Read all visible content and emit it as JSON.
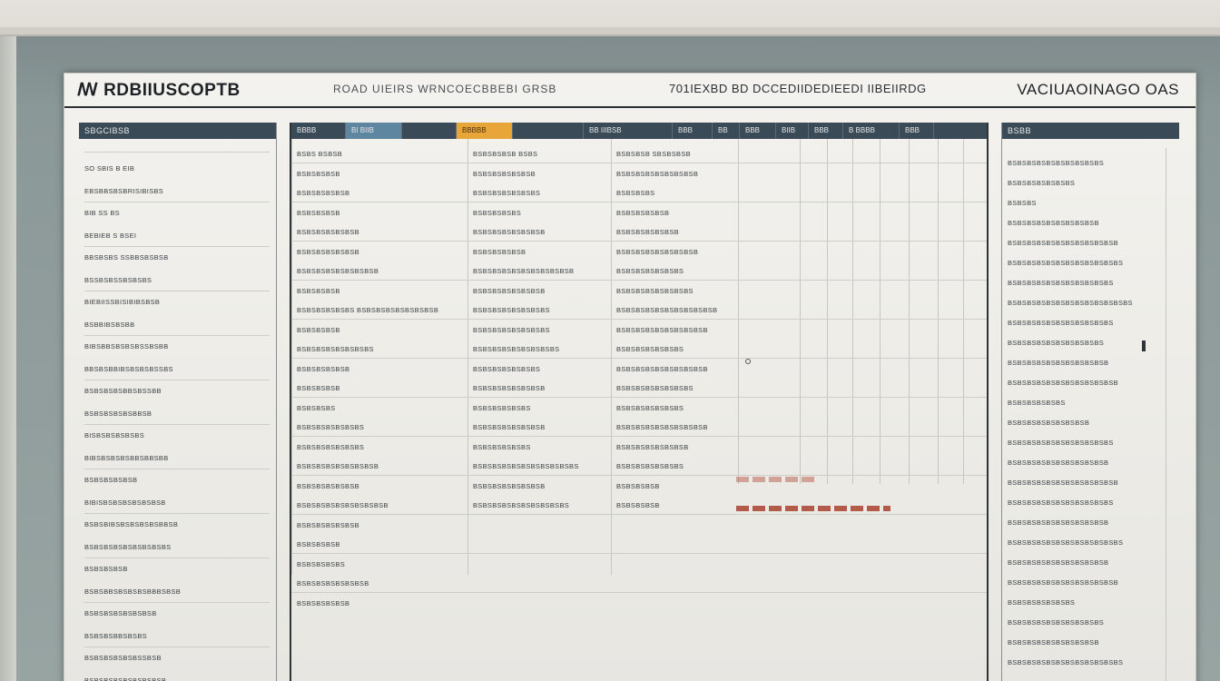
{
  "header": {
    "title_left": "ꟿ RDBIIUSCOPTB",
    "title_center_left": "ROAD UIEIRS WRNCOECBBEBI GRSB",
    "title_center_right": "701IEXBD BD DCCEDIIDEDIEEDI IIBEIIRDG",
    "title_right": "VACIUAOINAGO OAS"
  },
  "left_column": {
    "header": "SBGCIBSB",
    "rows": [
      "SO SBIS B EIB",
      "EBSBBSBSBRISIBISBS",
      "BIB SS BS",
      "BEBIEB S BSEI",
      "BBSBSBS SSBBSBSBSB",
      "BSSBSBSSBSBSBS",
      "BIEBIISSBISIBIBSBSB",
      "BSBBIBSBSBB",
      "BIBSBBSBSBSBSSBSBB",
      "BBSBSBBIBSBSBSBSSBS",
      "BSBSBSBSBBSBSSBB",
      "BSBSBSBSBSBBSB",
      "BISBSBSBSBSBS",
      "BIBSBSBSBSBBSBBSBB",
      "BSBSBSBSBSB",
      "BIBISBSBSBSBSBSBSB",
      "BSBSBIBSBSBSBSBSBBSB",
      "BSBSBSBSBSBSBSBSBS",
      "BSBSBSBSB",
      "BSBSBBSBSBSBSBBBSBSB",
      "BSBSBSBSBSBSBSB",
      "BSBSBSBBSBSBS",
      "BSBSBSBSBSBSSBSB",
      "BSBSBSBSBSBSBSBSB"
    ]
  },
  "mid_column": {
    "tabs": [
      "BBBB",
      "BI BIIB",
      "",
      "BBBBB",
      "",
      "BB IIIBSB",
      "BBB",
      "BB",
      "BBB",
      "BIIB",
      "BBB",
      "B BBBB",
      "BBB"
    ],
    "rows": [
      [
        "BSBS BSBSB",
        "BSBSBSBSB BSBS",
        "BSBSBSB SBSBSBSB"
      ],
      [
        "BSBSBSBSB",
        "BSBSBSBSBSBSB",
        "BSBSBSBSBSBSBSBSB"
      ],
      [
        "BSBSBSBSBSB",
        "BSBSBSBSBSBSBS",
        "BSBSBSBS"
      ],
      [
        "BSBSBSBSB",
        "BSBSBSBSBS",
        "BSBSBSBSBSB"
      ],
      [
        "BSBSBSBSBSBSB",
        "BSBSBSBSBSBSBSB",
        "BSBSBSBSBSBSB"
      ],
      [
        "BSBSBSBSBSBSB",
        "BSBSBSBSBSB",
        "BSBSBSBSBSBSBSBSB"
      ],
      [
        "BSBSBSBSBSBSBSBSB",
        "BSBSBSBSBSBSBSBSBSBSB",
        "BSBSBSBSBSBSBS"
      ],
      [
        "BSBSBSBSB",
        "BSBSBSBSBSBSBSB",
        "BSBSBSBSBSBSBSBS"
      ],
      [
        "BSBSBSBSBSBS BSBSBSBSBSBSBSBSB",
        "BSBSBSBSBSBSBSBS",
        "BSBSBSBSBSBSBSBSBSBSB"
      ],
      [
        "BSBSBSBSB",
        "BSBSBSBSBSBSBSBS",
        "BSBSBSBSBSBSBSBSBSB"
      ],
      [
        "BSBSBSBSBSBSBSBS",
        "BSBSBSBSBSBSBSBSBS",
        "BSBSBSBSBSBSBS"
      ],
      [
        "BSBSBSBSBSB",
        "BSBSBSBSBSBSBS",
        "BSBSBSBSBSBSBSBSBSB"
      ],
      [
        "BSBSBSBSB",
        "BSBSBSBSBSBSBSB",
        "BSBSBSBSBSBSBSBS"
      ],
      [
        "BSBSBSBS",
        "BSBSBSBSBSBS",
        "BSBSBSBSBSBSBS"
      ],
      [
        "BSBSBSBSBSBSBS",
        "BSBSBSBSBSBSBSB",
        "BSBSBSBSBSBSBSBSBSB"
      ],
      [
        "BSBSBSBSBSBSBS",
        "BSBSBSBSBSBS",
        "BSBSBSBSBSBSBSB"
      ],
      [
        "BSBSBSBSBSBSBSBSB",
        "BSBSBSBSBSBSBSBSBSBSBS",
        "BSBSBSBSBSBSBS"
      ],
      [
        "BSBSBSBSBSBSB",
        "BSBSBSBSBSBSBSB",
        "BSBSBSBSB"
      ],
      [
        "BSBSBSBSBSBSBSBSBSB",
        "BSBSBSBSBSBSBSBSBSBS",
        "BSBSBSBSB"
      ],
      [
        "BSBSBSBSBSBSB",
        "",
        ""
      ],
      [
        "BSBSBSBSB",
        "",
        ""
      ],
      [
        "BSBSBSBSBS",
        "",
        ""
      ],
      [
        "BSBSBSBSBSBSBSB",
        "",
        ""
      ],
      [
        "BSBSBSBSBSB",
        "",
        ""
      ]
    ]
  },
  "right_column": {
    "header": "BSBB",
    "rows": [
      "BSBSBSBSBSBSBSBSBSBS",
      "BSBSBSBSBSBSBS",
      "BSBSBS",
      "BSBSBSBSBSBSBSBSBSB",
      "BSBSBSBSBSBSBSBSBSBSBSB",
      "BSBSBSBSBSBSBSBSBSBSBSBS",
      "BSBSBSBSBSBSBSBSBSBSBS",
      "BSBSBSBSBSBSBSBSBSBSBSBSBS",
      "BSBSBSBSBSBSBSBSBSBSBS",
      "BSBSBSBSBSBSBSBSBSBS",
      "BSBSBSBSBSBSBSBSBSBSB",
      "BSBSBSBSBSBSBSBSBSBSBSB",
      "BSBSBSBSBSBS",
      "BSBSBSBSBSBSBSBSB",
      "BSBSBSBSBSBSBSBSBSBSBS",
      "BSBSBSBSBSBSBSBSBSBSB",
      "BSBSBSBSBSBSBSBSBSBSBSB",
      "BSBSBSBSBSBSBSBSBSBSBS",
      "BSBSBSBSBSBSBSBSBSBSB",
      "BSBSBSBSBSBSBSBSBSBSBSBS",
      "BSBSBSBSBSBSBSBSBSBSB",
      "BSBSBSBSBSBSBSBSBSBSBSB",
      "BSBSBSBSBSBSBS",
      "BSBSBSBSBSBSBSBSBSBS",
      "BSBSBSBSBSBSBSBSBSB",
      "BSBSBSBSBSBSBSBSBSBSBSBS"
    ]
  },
  "colors": {
    "header_bar": "#3a4a56",
    "tab_blue": "#5f86a0",
    "tab_amber": "#e8a53a",
    "dash_red": "#b45a4a"
  }
}
